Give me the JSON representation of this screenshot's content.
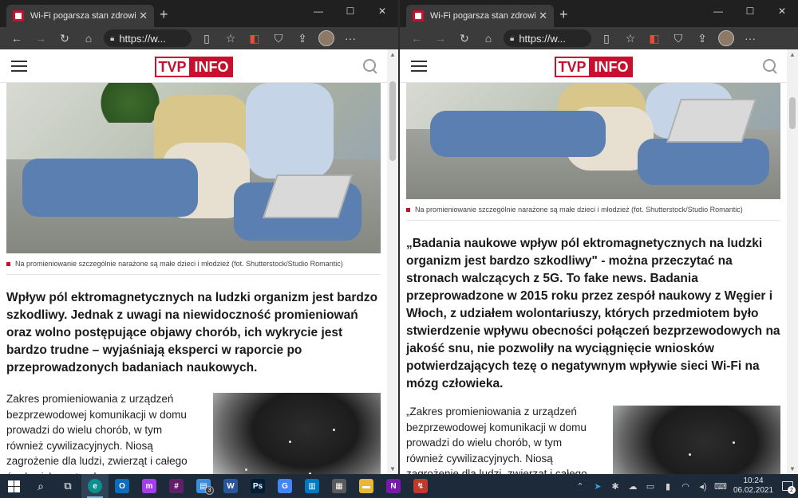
{
  "browser": {
    "tab_title": "Wi-Fi pogarsza stan zdrowia - tvp",
    "url": "https://w...",
    "new_tab": "+",
    "tab_close": "✕"
  },
  "site": {
    "logo_tvp": "TVP",
    "logo_info": "INFO"
  },
  "left_pane": {
    "caption": "Na promieniowanie szczególnie narażone są małe dzieci i młodzież (fot. Shutterstock/Studio Romantic)",
    "lead": "Wpływ pól ektromagnetycznych na ludzki organizm jest bardzo szkodliwy. Jednak z uwagi na niewidoczność promieniowań oraz wolno postępujące objawy chorób, ich wykrycie jest bardzo trudne – wyjaśniają eksperci w raporcie po przeprowadzonych badaniach naukowych.",
    "body": "Zakres promieniowania z urządzeń bezprzewodowej komunikacji w domu prowadzi do wielu chorób, w tym również cywilizacyjnych. Niosą zagrożenie dla ludzi, zwierząt i całego środowiska naturalnego"
  },
  "right_pane": {
    "caption": "Na promieniowanie szczególnie narażone są małe dzieci i młodzież (fot. Shutterstock/Studio Romantic)",
    "lead": "„Badania naukowe wpływ pól ektromagnetycznych na ludzki organizm jest bardzo szkodliwy\" - można przeczytać na stronach walczących z 5G. To fake news. Badania przeprowadzone w 2015 roku przez zespół naukowy z Węgier i Włoch, z udziałem wolontariuszy, których przedmiotem było stwierdzenie wpływu obecności połączeń bezprzewodowych na jakość snu, nie pozwoliły na wyciągnięcie wniosków potwierdzających tezę o negatywnym wpływie sieci Wi-Fi na mózg człowieka.",
    "body": "„Zakres promieniowania z urządzeń bezprzewodowej komunikacji w domu prowadzi do wielu chorób, w tym również cywilizacyjnych. Niosą zagrożenie dla ludzi, zwierząt i całego środowiska naturalnego\" - czytamy w"
  },
  "taskbar": {
    "time": "10:24",
    "date": "06.02.2021",
    "explorer_badge": "3",
    "notification_count": "2",
    "apps": [
      {
        "name": "outlook",
        "label": "O",
        "color": "#0f6cbd"
      },
      {
        "name": "messenger",
        "label": "m",
        "color": "#a33ef0"
      },
      {
        "name": "slack",
        "label": "#",
        "color": "#611f69"
      },
      {
        "name": "files",
        "label": "▤",
        "color": "#3a8de0"
      },
      {
        "name": "word",
        "label": "W",
        "color": "#2b579a"
      },
      {
        "name": "photoshop",
        "label": "Ps",
        "color": "#001e36"
      },
      {
        "name": "translate",
        "label": "G",
        "color": "#4285f4"
      },
      {
        "name": "trello",
        "label": "▥",
        "color": "#0079bf"
      },
      {
        "name": "calculator",
        "label": "▦",
        "color": "#5a5a5a"
      },
      {
        "name": "folder",
        "label": "▬",
        "color": "#e8b73a"
      },
      {
        "name": "onenote",
        "label": "N",
        "color": "#7719aa"
      },
      {
        "name": "app-red",
        "label": "↯",
        "color": "#c0392b"
      }
    ]
  }
}
